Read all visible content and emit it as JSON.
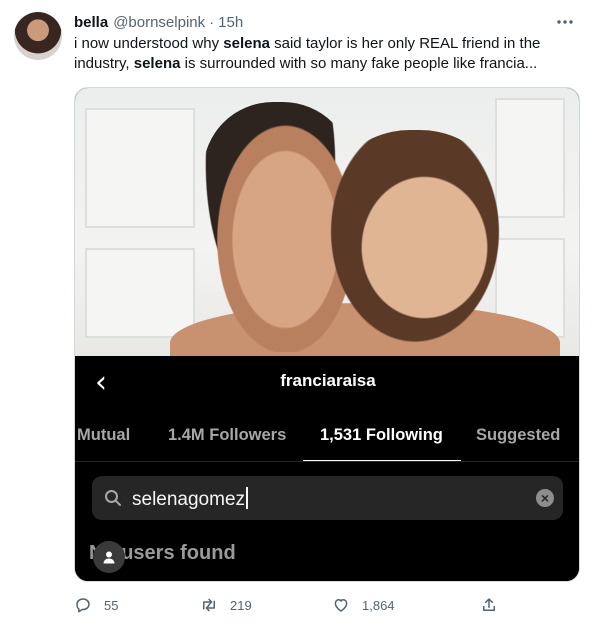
{
  "tweet": {
    "author_name": "bella",
    "author_handle": "@bornselpink",
    "separator": "·",
    "time": "15h",
    "more_label": "···",
    "text_parts": [
      {
        "t": "i now understood why ",
        "b": false
      },
      {
        "t": "selena",
        "b": true
      },
      {
        "t": " said taylor is her only REAL friend in the industry, ",
        "b": false
      },
      {
        "t": "selena",
        "b": true
      },
      {
        "t": " is surrounded with so many fake people like francia...",
        "b": false
      }
    ]
  },
  "screenshot": {
    "back_glyph": "‹",
    "username": "franciaraisa",
    "tabs": [
      {
        "label": "Mutual",
        "active": false
      },
      {
        "label": "1.4M Followers",
        "active": false
      },
      {
        "label": "1,531 Following",
        "active": true
      },
      {
        "label": "Suggested",
        "active": false
      }
    ],
    "search_value": "selenagomez",
    "clear_glyph": "×",
    "empty_message": "No users found"
  },
  "actions": {
    "replies": "55",
    "retweets": "219",
    "likes": "1,864"
  },
  "colors": {
    "text_primary": "#0f1419",
    "text_secondary": "#536471",
    "instagram_bg": "#000000",
    "search_bg": "#262626"
  }
}
